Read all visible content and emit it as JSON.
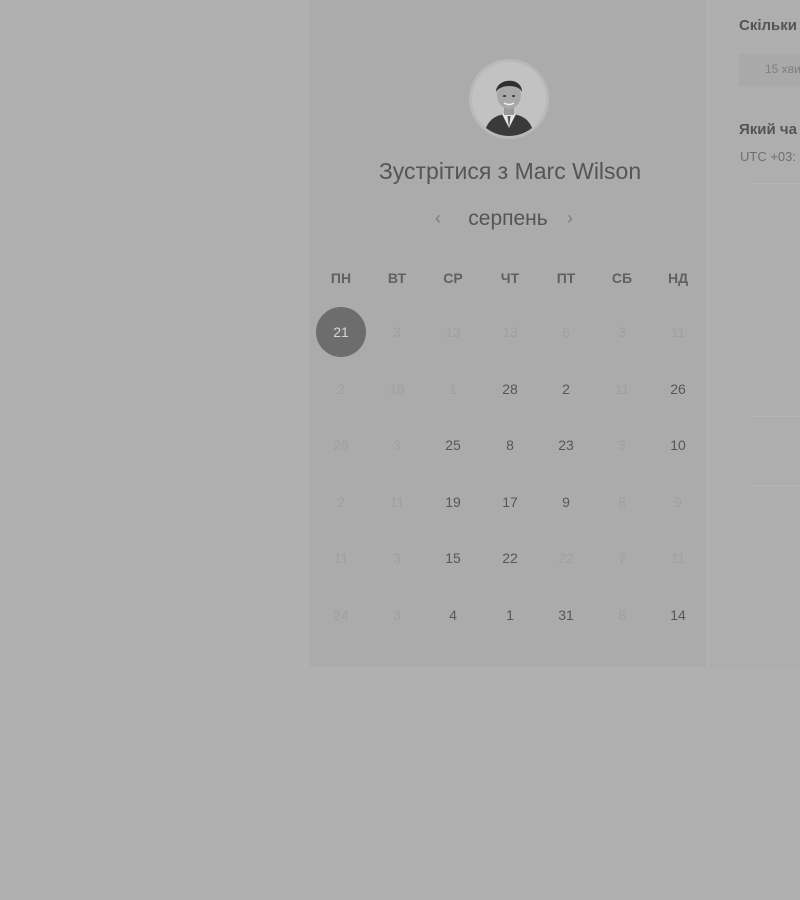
{
  "meeting": {
    "title": "Зустрітися з Marc Wilson"
  },
  "calendar": {
    "month": "серпень",
    "prev_icon": "‹",
    "next_icon": "›",
    "weekdays": [
      "ПН",
      "ВТ",
      "СР",
      "ЧТ",
      "ПТ",
      "СБ",
      "НД"
    ],
    "weeks": [
      [
        {
          "label": "21",
          "state": "selected"
        },
        {
          "label": "3",
          "state": "unavailable"
        },
        {
          "label": "13",
          "state": "unavailable"
        },
        {
          "label": "13",
          "state": "unavailable"
        },
        {
          "label": "6",
          "state": "unavailable"
        },
        {
          "label": "3",
          "state": "unavailable"
        },
        {
          "label": "11",
          "state": "unavailable"
        }
      ],
      [
        {
          "label": "2",
          "state": "unavailable"
        },
        {
          "label": "16",
          "state": "unavailable"
        },
        {
          "label": "1",
          "state": "unavailable"
        },
        {
          "label": "28",
          "state": "available"
        },
        {
          "label": "2",
          "state": "available"
        },
        {
          "label": "11",
          "state": "unavailable"
        },
        {
          "label": "26",
          "state": "available"
        }
      ],
      [
        {
          "label": "26",
          "state": "unavailable"
        },
        {
          "label": "3",
          "state": "unavailable"
        },
        {
          "label": "25",
          "state": "available"
        },
        {
          "label": "8",
          "state": "available"
        },
        {
          "label": "23",
          "state": "available"
        },
        {
          "label": "3",
          "state": "unavailable"
        },
        {
          "label": "10",
          "state": "available"
        }
      ],
      [
        {
          "label": "2",
          "state": "unavailable"
        },
        {
          "label": "11",
          "state": "unavailable"
        },
        {
          "label": "19",
          "state": "available"
        },
        {
          "label": "17",
          "state": "available"
        },
        {
          "label": "9",
          "state": "available"
        },
        {
          "label": "8",
          "state": "unavailable"
        },
        {
          "label": "9",
          "state": "unavailable"
        }
      ],
      [
        {
          "label": "11",
          "state": "unavailable"
        },
        {
          "label": "3",
          "state": "unavailable"
        },
        {
          "label": "15",
          "state": "available"
        },
        {
          "label": "22",
          "state": "available"
        },
        {
          "label": "22",
          "state": "unavailable"
        },
        {
          "label": "7",
          "state": "unavailable"
        },
        {
          "label": "11",
          "state": "unavailable"
        }
      ],
      [
        {
          "label": "24",
          "state": "unavailable"
        },
        {
          "label": "3",
          "state": "unavailable"
        },
        {
          "label": "4",
          "state": "available"
        },
        {
          "label": "1",
          "state": "available"
        },
        {
          "label": "31",
          "state": "available"
        },
        {
          "label": "8",
          "state": "unavailable"
        },
        {
          "label": "14",
          "state": "available"
        }
      ]
    ]
  },
  "sidebar": {
    "duration_label": "Скільки",
    "duration_value": "15 хви",
    "time_label": "Який ча",
    "timezone": "UTC +03:"
  }
}
